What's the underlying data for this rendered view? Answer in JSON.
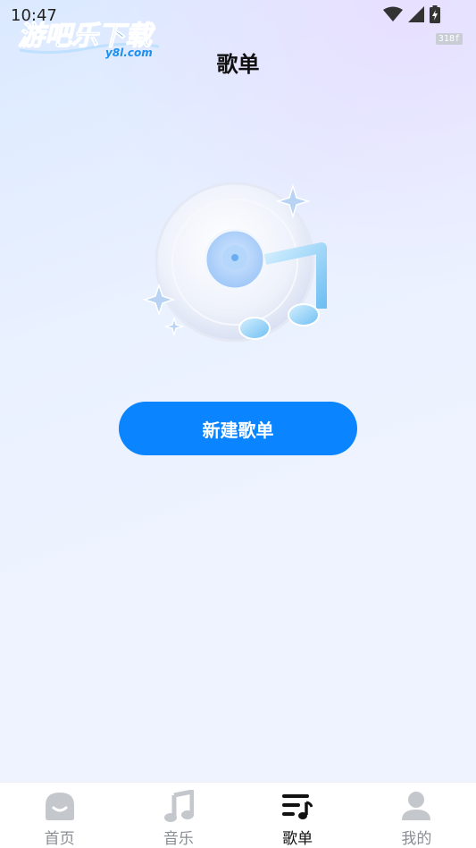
{
  "status_bar": {
    "time": "10:47",
    "fps": "318f",
    "icons": [
      "wifi-icon",
      "signal-icon",
      "battery-charging-icon"
    ]
  },
  "watermark": {
    "brand": "游吧乐下载",
    "domain": "y8l.com"
  },
  "header": {
    "title": "歌单"
  },
  "main": {
    "illustration": "music-disc-illustration",
    "new_playlist_label": "新建歌单"
  },
  "bottom_nav": {
    "items": [
      {
        "label": "首页",
        "icon": "home-icon",
        "active": false
      },
      {
        "label": "音乐",
        "icon": "music-note-icon",
        "active": false
      },
      {
        "label": "歌单",
        "icon": "playlist-icon",
        "active": true
      },
      {
        "label": "我的",
        "icon": "profile-icon",
        "active": false
      }
    ]
  },
  "colors": {
    "accent": "#0a84ff",
    "nav_inactive": "#8a8d93",
    "nav_active": "#111111",
    "icon_inactive": "#c4c7cc"
  }
}
